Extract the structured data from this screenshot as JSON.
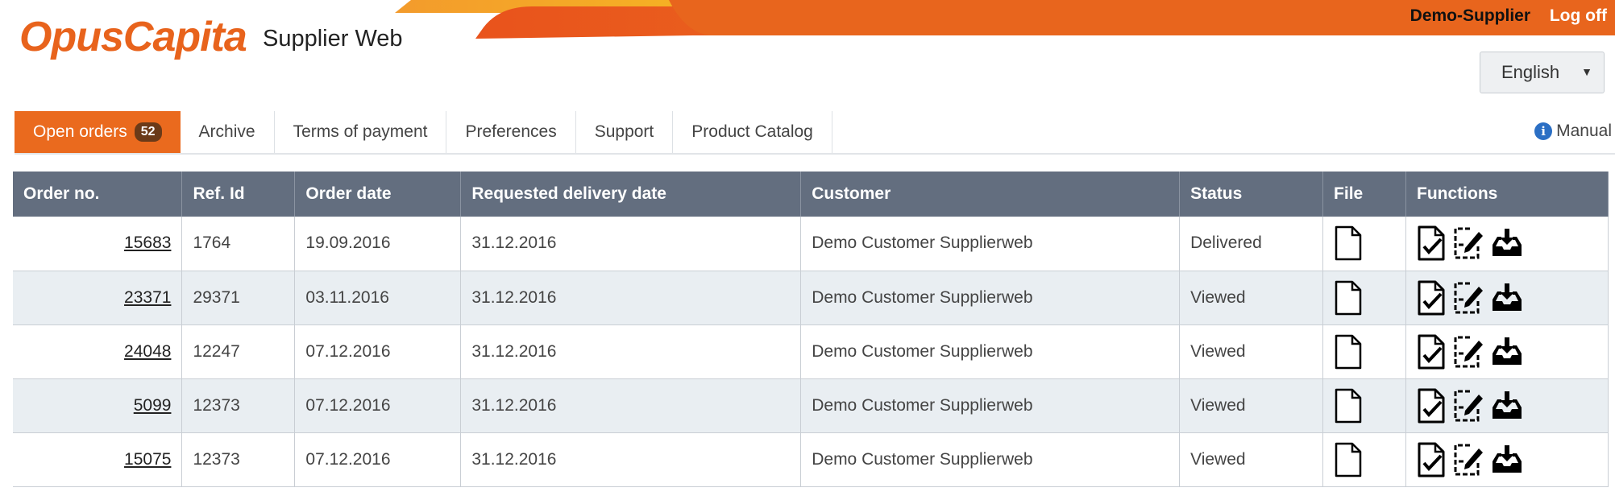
{
  "header": {
    "logo": "OpusCapita",
    "app_name": "Supplier Web",
    "user": "Demo-Supplier",
    "logoff": "Log off",
    "language": "English"
  },
  "tabs": [
    {
      "label": "Open orders",
      "badge": "52"
    },
    {
      "label": "Archive"
    },
    {
      "label": "Terms of payment"
    },
    {
      "label": "Preferences"
    },
    {
      "label": "Support"
    },
    {
      "label": "Product Catalog"
    }
  ],
  "manual": "Manual",
  "table": {
    "headers": [
      "Order no.",
      "Ref. Id",
      "Order date",
      "Requested delivery date",
      "Customer",
      "Status",
      "File",
      "Functions"
    ],
    "rows": [
      {
        "order": "15683",
        "ref": "1764",
        "date": "19.09.2016",
        "delivery": "31.12.2016",
        "customer": "Demo Customer Supplierweb",
        "status": "Delivered"
      },
      {
        "order": "23371",
        "ref": "29371",
        "date": "03.11.2016",
        "delivery": "31.12.2016",
        "customer": "Demo Customer Supplierweb",
        "status": "Viewed"
      },
      {
        "order": "24048",
        "ref": "12247",
        "date": "07.12.2016",
        "delivery": "31.12.2016",
        "customer": "Demo Customer Supplierweb",
        "status": "Viewed"
      },
      {
        "order": "5099",
        "ref": "12373",
        "date": "07.12.2016",
        "delivery": "31.12.2016",
        "customer": "Demo Customer Supplierweb",
        "status": "Viewed"
      },
      {
        "order": "15075",
        "ref": "12373",
        "date": "07.12.2016",
        "delivery": "31.12.2016",
        "customer": "Demo Customer Supplierweb",
        "status": "Viewed"
      }
    ]
  },
  "icons": {
    "file": "document-icon",
    "confirm": "document-check-icon",
    "edit": "document-edit-icon",
    "download": "inbox-download-icon",
    "info": "info-icon"
  },
  "colors": {
    "brand_orange": "#e8631c",
    "header_bar": "#636e7f",
    "row_alt": "#e9eef2",
    "info_blue": "#2b6fc4"
  }
}
